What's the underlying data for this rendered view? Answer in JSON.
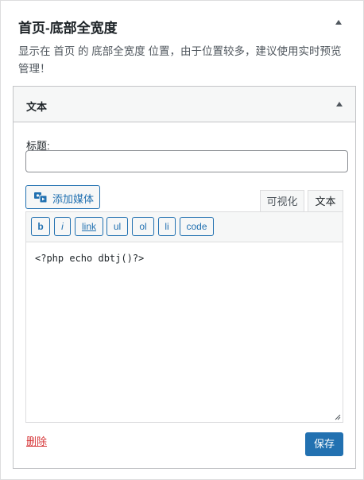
{
  "panel": {
    "title": "首页-底部全宽度",
    "description": "显示在 首页 的 底部全宽度 位置，由于位置较多，建议使用实时预览管理！"
  },
  "widget": {
    "title": "文本",
    "title_field_label": "标题:",
    "title_field_value": "",
    "add_media_label": "添加媒体",
    "tabs": {
      "visual": "可视化",
      "text": "文本"
    },
    "quicktags": [
      "b",
      "i",
      "link",
      "ul",
      "ol",
      "li",
      "code"
    ],
    "editor_content": "<?php echo dbtj()?>",
    "delete_label": "删除",
    "save_label": "保存"
  },
  "colors": {
    "accent": "#2271b1",
    "delete": "#d63638",
    "border": "#dcdcde"
  },
  "icons": {
    "collapse": "caret-up-icon",
    "media": "media-icon"
  }
}
